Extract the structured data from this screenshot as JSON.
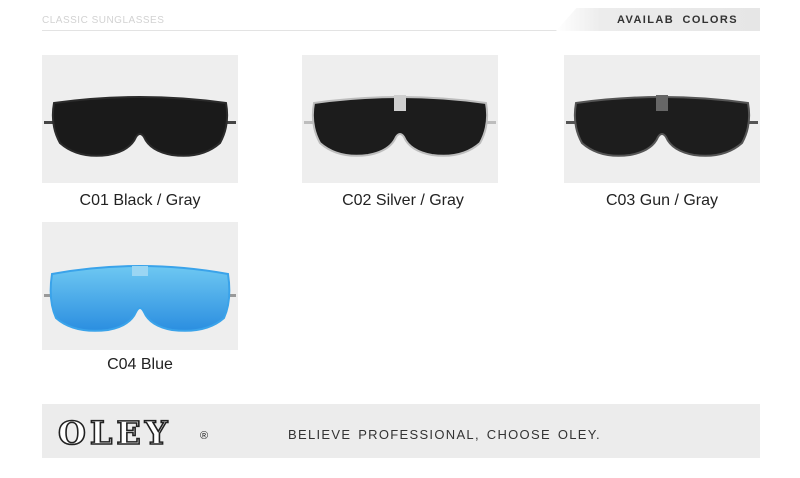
{
  "header": {
    "section_label": "CLASSIC SUNGLASSES",
    "colors_title": "AVAILAB COLORS"
  },
  "products": [
    {
      "code": "C01",
      "caption": "C01 Black / Gray",
      "frame_color": "#2b2b2b",
      "lens_color": "#1a1a1a"
    },
    {
      "code": "C02",
      "caption": "C02 Silver / Gray",
      "frame_color": "#bdbdbd",
      "lens_color": "#1c1c1c"
    },
    {
      "code": "C03",
      "caption": "C03 Gun / Gray",
      "frame_color": "#555555",
      "lens_color": "#1d1d1d"
    },
    {
      "code": "C04",
      "caption": "C04 Blue",
      "frame_color": "#9a9a9a",
      "lens_color": "#3aa3ea"
    }
  ],
  "footer": {
    "logo": "OLEY",
    "registered": "®",
    "slogan": "BELIEVE PROFESSIONAL, CHOOSE OLEY."
  }
}
